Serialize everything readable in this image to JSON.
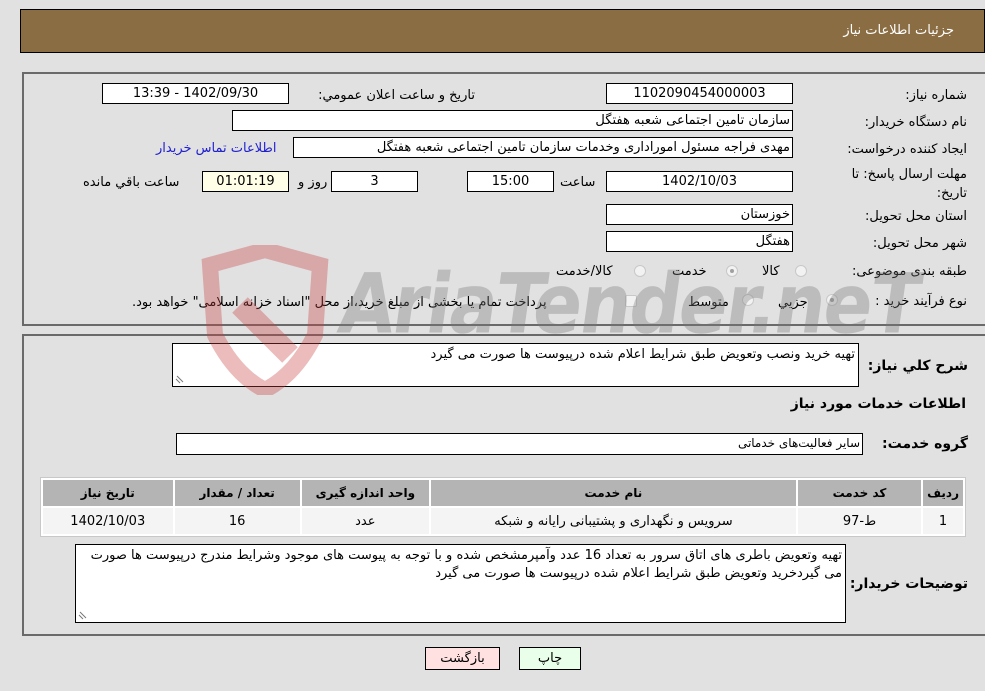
{
  "header": {
    "title": "جزئیات اطلاعات نیاز"
  },
  "form": {
    "need_number": {
      "label": "شماره نیاز:",
      "value": "1102090454000003"
    },
    "announce_datetime": {
      "label": "تاریخ و ساعت اعلان عمومي:",
      "value": "1402/09/30 - 13:39"
    },
    "buyer_org": {
      "label": "نام دستگاه خريدار:",
      "value": "سازمان تامین اجتماعی شعبه هفتگل"
    },
    "requester": {
      "label": "ایجاد کننده درخواست:",
      "value": "مهدی فراجه مسئول اموراداری وخدمات سازمان تامین اجتماعی شعبه هفتگل"
    },
    "buyer_contact_link": "اطلاعات تماس خريدار",
    "deadline": {
      "label": "مهلت ارسال پاسخ: تا تاریخ:",
      "date": "1402/10/03",
      "time_label": "ساعت",
      "time": "15:00",
      "days": "3",
      "days_label": "روز و",
      "remaining": "01:01:19",
      "remaining_label": "ساعت باقي مانده"
    },
    "province": {
      "label": "استان محل تحويل:",
      "value": "خوزستان"
    },
    "city": {
      "label": "شهر محل تحويل:",
      "value": "هفتگل"
    },
    "category": {
      "label": "طبقه بندی موضوعی:",
      "options": [
        "کالا",
        "خدمت",
        "کالا/خدمت"
      ],
      "selected": "خدمت"
    },
    "purchase_type": {
      "label": "نوع فرآیند خرید :",
      "options": [
        "جزيي",
        "متوسط"
      ],
      "selected": "جزيي",
      "treasury_note": "پرداخت تمام یا بخشی از مبلغ خرید،از محل \"اسناد خزانه اسلامی\" خواهد بود."
    }
  },
  "details": {
    "description_label": "شرح کلي نياز:",
    "description": "تهیه خرید ونصب وتعویض طبق شرایط اعلام شده درپیوست ها صورت می گیرد",
    "services_title": "اطلاعات خدمات مورد نياز",
    "service_group_label": "گروه خدمت:",
    "service_group": "سایر فعالیت‌های خدماتی",
    "table": {
      "headers": [
        "رديف",
        "کد خدمت",
        "نام خدمت",
        "واحد اندازه گيری",
        "تعداد / مقدار",
        "تاریخ نیاز"
      ],
      "rows": [
        [
          "1",
          "ط-97",
          "سرویس و نگهداری و پشتیبانی رایانه و شبکه",
          "عدد",
          "16",
          "1402/10/03"
        ]
      ]
    },
    "buyer_notes_label": "توضيحات خريدار:",
    "buyer_notes": "تهیه وتعویض باطری های اتاق سرور به تعداد 16 عدد وآمپرمشخص شده و با توجه به پیوست های موجود وشرایط مندرج درپیوست ها صورت می گیردخرید وتعویض طبق شرایط اعلام شده درپیوست ها صورت می گیرد"
  },
  "buttons": {
    "print": "چاپ",
    "back": "بازگشت"
  },
  "colors": {
    "header_bg": "#8b6d43",
    "print_bg": "#eaffea",
    "back_bg": "#ffe1e1",
    "link": "#2020d0"
  },
  "watermark": "AriaTender.neT"
}
